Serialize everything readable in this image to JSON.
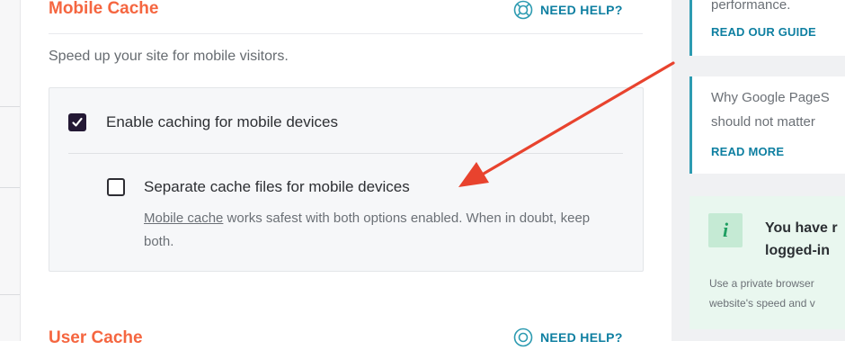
{
  "mobile_cache": {
    "title": "Mobile Cache",
    "help_label": "NEED HELP?",
    "description": "Speed up your site for mobile visitors.",
    "enable_mobile": {
      "label": "Enable caching for mobile devices",
      "checked": true
    },
    "separate_files": {
      "label": "Separate cache files for mobile devices",
      "checked": false
    },
    "helptext_link": "Mobile cache",
    "helptext_rest": " works safest with both options enabled. When in doubt, keep both."
  },
  "user_cache": {
    "title": "User Cache",
    "help_label": "NEED HELP?"
  },
  "sidebar": {
    "card1": {
      "text": "performance.",
      "link": "READ OUR GUIDE"
    },
    "card2": {
      "text_line1": "Why Google PageS",
      "text_line2": "should not matter",
      "link": "READ MORE"
    },
    "notice": {
      "icon_glyph": "i",
      "title_line1": "You have r",
      "title_line2": "logged-in",
      "text_line1": "Use a private browser",
      "text_line2": "website's speed and v"
    }
  },
  "colors": {
    "accent_orange": "#f56640",
    "link_teal": "#0e7fa1",
    "checkbox_dark": "#231834",
    "annotation_arrow": "#e8432e"
  },
  "icons": {
    "help": "lifebuoy-icon",
    "check": "checkmark-icon",
    "info": "info-icon",
    "arrow": "annotation-arrow"
  }
}
